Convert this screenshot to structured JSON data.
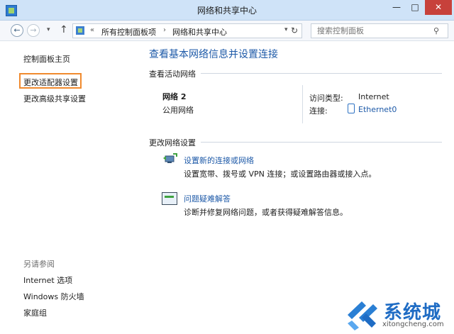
{
  "window": {
    "title": "网络和共享中心",
    "controls": {
      "minimize": "—",
      "maximize": "□",
      "close": "✕"
    }
  },
  "navbar": {
    "back": "←",
    "forward": "→",
    "recent": "▾",
    "up": "↑",
    "breadcrumb_chevron": "«",
    "crumbs": [
      "所有控制面板项",
      "网络和共享中心"
    ],
    "crumb_separator": "›",
    "dropdown": "▾",
    "refresh": "↻",
    "search_placeholder": "搜索控制面板",
    "search_icon": "⚲"
  },
  "left_pane": {
    "home": "控制面板主页",
    "adapter_settings": "更改适配器设置",
    "advanced_sharing": "更改高级共享设置",
    "see_also": {
      "title": "另请参阅",
      "items": [
        "Internet 选项",
        "Windows 防火墙",
        "家庭组"
      ]
    }
  },
  "main": {
    "title": "查看基本网络信息并设置连接",
    "active_networks": {
      "heading": "查看活动网络",
      "network_name": "网络 2",
      "network_type": "公用网络",
      "access_type_label": "访问类型:",
      "access_type_value": "Internet",
      "connections_label": "连接:",
      "connection_value": "Ethernet0"
    },
    "change_settings": {
      "heading": "更改网络设置",
      "tasks": [
        {
          "link": "设置新的连接或网络",
          "desc": "设置宽带、拨号或 VPN 连接；或设置路由器或接入点。"
        },
        {
          "link": "问题疑难解答",
          "desc": "诊断并修复网络问题，或者获得疑难解答信息。"
        }
      ]
    }
  },
  "watermark": {
    "name": "系统城",
    "url": "xitongcheng.com"
  },
  "colors": {
    "link": "#1e5aa8",
    "highlight": "#f08a2e",
    "close_button": "#c7413b",
    "titlebar": "#cfe3f8"
  }
}
